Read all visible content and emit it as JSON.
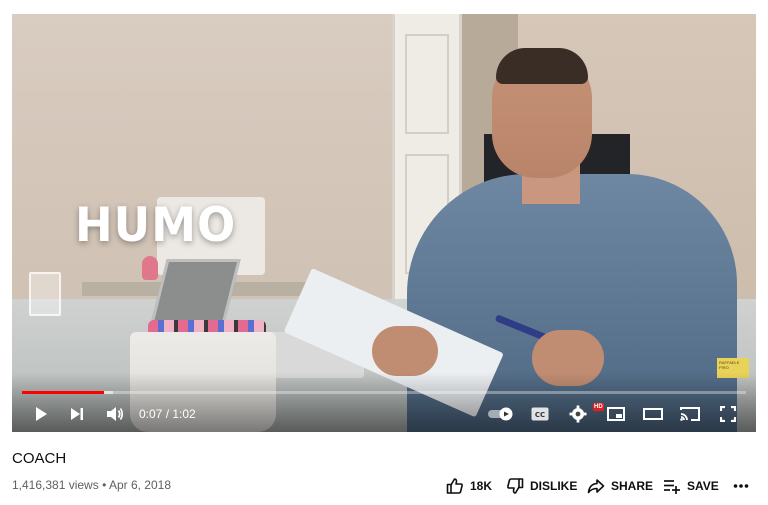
{
  "player": {
    "overlay_text": "HUMO",
    "watermark_text": "RAFFAELE PIRO",
    "time_current": "0:07",
    "time_separator": " / ",
    "time_total": "1:02",
    "progress_played_fraction": 0.113,
    "progress_buffer_fraction": 0.125,
    "hd_badge": "HD",
    "accent_color": "#ff0000",
    "icons": {
      "play": "play-icon",
      "next": "next-icon",
      "volume": "volume-icon",
      "autoplay": "autoplay-toggle-icon",
      "captions": "cc-icon",
      "settings": "gear-icon",
      "miniplayer": "miniplayer-icon",
      "theater": "theater-mode-icon",
      "cast": "cast-icon",
      "fullscreen": "fullscreen-icon"
    },
    "captions_label": "CC"
  },
  "video": {
    "title": "COACH",
    "views": "1,416,381 views",
    "separator": " • ",
    "date": "Apr 6, 2018"
  },
  "actions": {
    "like_count": "18K",
    "dislike_label": "DISLIKE",
    "share_label": "SHARE",
    "save_label": "SAVE",
    "more_label": "..."
  }
}
